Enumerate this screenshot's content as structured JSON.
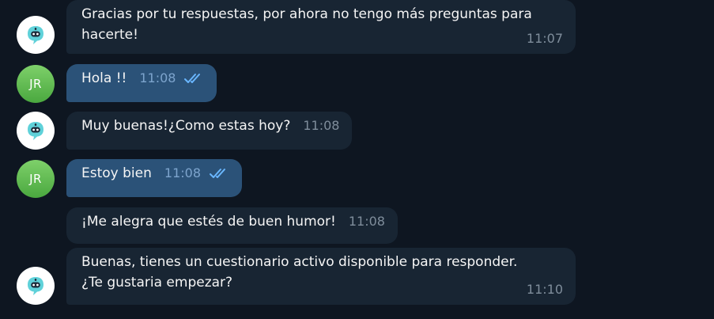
{
  "messages": [
    {
      "sender": "bot",
      "text": "Gracias por tu respuestas, por ahora no tengo más preguntas para\nhacerte!",
      "time": "11:07"
    },
    {
      "sender": "user",
      "text": "Hola !!",
      "time": "11:08",
      "read": true
    },
    {
      "sender": "bot",
      "text": "Muy buenas!¿Como estas hoy?",
      "time": "11:08"
    },
    {
      "sender": "user",
      "text": "Estoy bien",
      "time": "11:08",
      "read": true
    },
    {
      "sender": "bot",
      "text": "¡Me alegra que estés de buen humor!",
      "time": "11:08"
    },
    {
      "sender": "bot",
      "text": "Buenas, tienes un cuestionario activo disponible para responder.\n¿Te gustaria empezar?",
      "time": "11:10"
    }
  ],
  "user_initials": "JR",
  "colors": {
    "background": "#0e1621",
    "incoming_bubble": "#182533",
    "outgoing_bubble": "#2b5278",
    "read_ticks": "#6ab7ff"
  },
  "icons": {
    "bot_avatar": "robot-chat-icon",
    "read_status": "double-check-icon"
  }
}
